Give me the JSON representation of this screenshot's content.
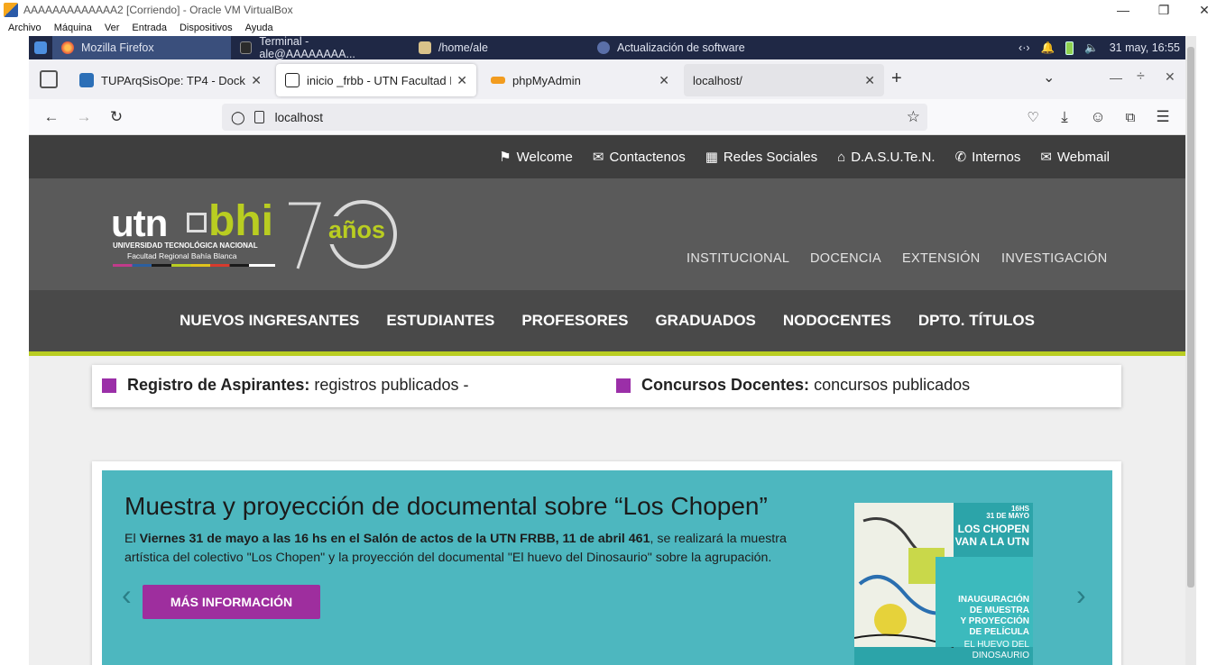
{
  "vbox": {
    "title": "AAAAAAAAAAAAA2 [Corriendo] - Oracle VM VirtualBox",
    "menu": [
      "Archivo",
      "Máquina",
      "Ver",
      "Entrada",
      "Dispositivos",
      "Ayuda"
    ]
  },
  "taskbar": {
    "tasks": [
      "Mozilla Firefox",
      "Terminal - ale@AAAAAAAA...",
      "/home/ale",
      "Actualización de software"
    ],
    "clock": "31 may, 16:55"
  },
  "browser": {
    "tabs": [
      {
        "label": "TUPArqSisOpe: TP4 - Docker"
      },
      {
        "label": "inicio _frbb - UTN Facultad Re"
      },
      {
        "label": "phpMyAdmin"
      },
      {
        "label": "localhost/"
      }
    ],
    "url": "localhost"
  },
  "site": {
    "toplinks": [
      "Welcome",
      "Contactenos",
      "Redes Sociales",
      "D.A.S.U.Te.N.",
      "Internos",
      "Webmail"
    ],
    "logo": {
      "utn": "utn",
      "bhi": "bhi",
      "line1": "UNIVERSIDAD TECNOLÓGICA NACIONAL",
      "line2": "Facultad Regional Bahía Blanca",
      "anos": "años"
    },
    "headnav": [
      "INSTITUCIONAL",
      "DOCENCIA",
      "EXTENSIÓN",
      "INVESTIGACIÓN"
    ],
    "mainnav": [
      "NUEVOS INGRESANTES",
      "ESTUDIANTES",
      "PROFESORES",
      "GRADUADOS",
      "NODOCENTES",
      "DPTO. TÍTULOS"
    ],
    "ticker": [
      {
        "bold": "Registro de Aspirantes:",
        "text": "registros publicados -"
      },
      {
        "bold": "Concursos Docentes:",
        "text": "concursos publicados"
      }
    ],
    "slide": {
      "title": "Muestra y proyección de documental sobre “Los Chopen”",
      "p_pre": "El ",
      "p_bold": "Viernes 31 de mayo a las 16 hs en el Salón de actos de la UTN FRBB, 11 de abril 461",
      "p_post": ", se realizará la muestra artística del colectivo \"Los Chopen\" y la proyección del documental \"El huevo del Dinosaurio\" sobre la agrupación.",
      "cta": "MÁS INFORMACIÓN",
      "poster": {
        "top": "16HS",
        "date": "31 DE MAYO",
        "head1": "LOS CHOPEN",
        "head2": "VAN A LA UTN",
        "sub1": "INAUGURACIÓN",
        "sub2": "DE MUESTRA",
        "sub3": "Y PROYECCIÓN",
        "sub4": "DE PELÍCULA",
        "sub5": "EL HUEVO DEL",
        "sub6": "DINOSAURIO"
      }
    }
  },
  "colors": {
    "accent_lime": "#b9cd21",
    "accent_purple": "#9b2fa8",
    "slide_bg": "#4db7bf"
  }
}
